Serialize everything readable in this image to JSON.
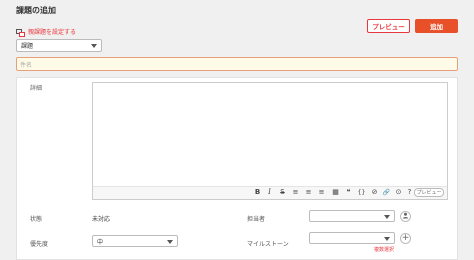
{
  "header": {
    "title": "課題の追加"
  },
  "parent_issue": {
    "label": "親課題を設定する",
    "icon": "parent-issue-icon"
  },
  "actions": {
    "preview_label": "プレビュー",
    "add_label": "追加"
  },
  "issue_type": {
    "value": "課題"
  },
  "subject": {
    "placeholder": "件名"
  },
  "details": {
    "label": "詳細",
    "toolbar_icons": [
      "B",
      "I",
      "S",
      "≡",
      "≡",
      "≡",
      "▦",
      "❝",
      "{}",
      "⊘",
      "🔗",
      "⊙",
      "?"
    ],
    "preview_label": "プレビュー"
  },
  "fields": {
    "status_label": "状態",
    "status_value": "未対応",
    "assignee_label": "担当者",
    "priority_label": "優先度",
    "priority_value": "中",
    "milestone_label": "マイルストーン",
    "multi_select_label": "複数選択"
  },
  "colors": {
    "accent": "#e8383d",
    "primary_button": "#e8502a",
    "subject_bg": "#fffbe6"
  }
}
